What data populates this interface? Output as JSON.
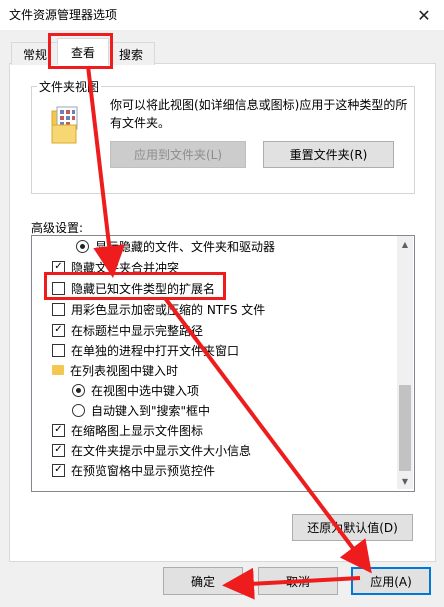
{
  "window": {
    "title": "文件资源管理器选项",
    "close_glyph": "✕"
  },
  "tabs": [
    {
      "label": "常规",
      "active": false
    },
    {
      "label": "查看",
      "active": true
    },
    {
      "label": "搜索",
      "active": false
    }
  ],
  "folder_views": {
    "title": "文件夹视图",
    "description": "你可以将此视图(如详细信息或图标)应用于这种类型的所有文件夹。",
    "apply_button": "应用到文件夹(L)",
    "reset_button": "重置文件夹(R)"
  },
  "advanced": {
    "label": "高级设置:",
    "items": [
      {
        "type": "radio",
        "checked": true,
        "label": "显示隐藏的文件、文件夹和驱动器"
      },
      {
        "type": "checkbox",
        "checked": true,
        "label": "隐藏文件夹合并冲突"
      },
      {
        "type": "checkbox",
        "checked": false,
        "label": "隐藏已知文件类型的扩展名"
      },
      {
        "type": "checkbox",
        "checked": false,
        "label": "用彩色显示加密或压缩的 NTFS 文件"
      },
      {
        "type": "checkbox",
        "checked": true,
        "label": "在标题栏中显示完整路径"
      },
      {
        "type": "checkbox",
        "checked": false,
        "label": "在单独的进程中打开文件夹窗口"
      },
      {
        "type": "folder",
        "checked": false,
        "label": "在列表视图中键入时"
      },
      {
        "type": "radio",
        "checked": true,
        "label": "在视图中选中键入项"
      },
      {
        "type": "radio",
        "checked": false,
        "label": "自动键入到\"搜索\"框中"
      },
      {
        "type": "checkbox",
        "checked": true,
        "label": "在缩略图上显示文件图标"
      },
      {
        "type": "checkbox",
        "checked": true,
        "label": "在文件夹提示中显示文件大小信息"
      },
      {
        "type": "checkbox",
        "checked": true,
        "label": "在预览窗格中显示预览控件"
      }
    ],
    "restore_button": "还原为默认值(D)"
  },
  "footer": {
    "ok": "确定",
    "cancel": "取消",
    "apply": "应用(A)"
  },
  "icons": {
    "checkmark": "✓",
    "scroll_up": "▲",
    "scroll_down": "▼"
  },
  "colors": {
    "annotation_red": "#ee1c1c",
    "focus_blue": "#0078d7",
    "folder_yellow": "#f3c851"
  }
}
